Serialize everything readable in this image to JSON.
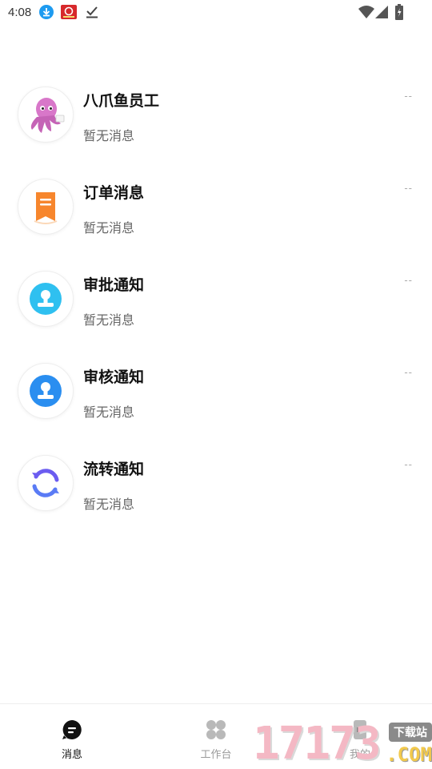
{
  "status_bar": {
    "time": "4:08",
    "icons": [
      "download-icon",
      "app-notification-icon",
      "check-download-icon",
      "wifi-icon",
      "signal-icon",
      "battery-icon"
    ]
  },
  "messages": [
    {
      "title": "八爪鱼员工",
      "subtitle": "暂无消息",
      "time": "--",
      "icon": "octopus-avatar",
      "accent": "#d46cc5"
    },
    {
      "title": "订单消息",
      "subtitle": "暂无消息",
      "time": "--",
      "icon": "order-receipt-icon",
      "accent": "#f7862d"
    },
    {
      "title": "审批通知",
      "subtitle": "暂无消息",
      "time": "--",
      "icon": "approval-stamp-icon",
      "accent": "#2fc0f0"
    },
    {
      "title": "审核通知",
      "subtitle": "暂无消息",
      "time": "--",
      "icon": "review-stamp-icon",
      "accent": "#2a8ef0"
    },
    {
      "title": "流转通知",
      "subtitle": "暂无消息",
      "time": "--",
      "icon": "transfer-cycle-icon",
      "accent": "#6b5cf0"
    }
  ],
  "tabs": [
    {
      "label": "消息",
      "icon": "message-bubble-icon",
      "active": true
    },
    {
      "label": "工作台",
      "icon": "workbench-grid-icon",
      "active": false
    },
    {
      "label": "我的",
      "icon": "profile-icon",
      "active": false
    }
  ],
  "watermark": {
    "digits": "17173",
    "badge": "下载站",
    "domain": ".COM"
  },
  "colors": {
    "active_tab": "#111111",
    "inactive_tab": "#9b9b9b",
    "subtitle": "#666666"
  }
}
